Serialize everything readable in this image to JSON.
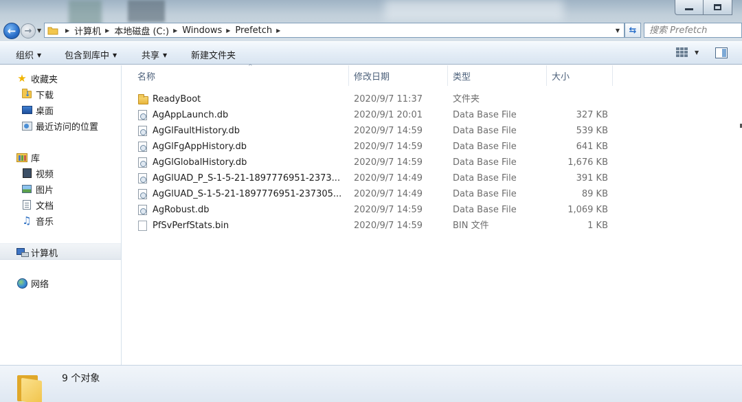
{
  "address": {
    "breadcrumbs": [
      "计算机",
      "本地磁盘 (C:)",
      "Windows",
      "Prefetch"
    ]
  },
  "search": {
    "placeholder": "搜索 Prefetch"
  },
  "toolbar": {
    "organize": "组织",
    "include_library": "包含到库中",
    "share": "共享",
    "new_folder": "新建文件夹"
  },
  "nav": {
    "favorites": "收藏夹",
    "downloads": "下载",
    "desktop": "桌面",
    "recent": "最近访问的位置",
    "libraries": "库",
    "videos": "视频",
    "pictures": "图片",
    "documents": "文档",
    "music": "音乐",
    "computer": "计算机",
    "network": "网络"
  },
  "columns": {
    "name": "名称",
    "modified": "修改日期",
    "type": "类型",
    "size": "大小"
  },
  "files": [
    {
      "name": "ReadyBoot",
      "modified": "2020/9/7 11:37",
      "type": "文件夹",
      "size": "",
      "icon": "folder-icon"
    },
    {
      "name": "AgAppLaunch.db",
      "modified": "2020/9/1 20:01",
      "type": "Data Base File",
      "size": "327 KB",
      "icon": "db-file-icon"
    },
    {
      "name": "AgGlFaultHistory.db",
      "modified": "2020/9/7 14:59",
      "type": "Data Base File",
      "size": "539 KB",
      "icon": "db-file-icon"
    },
    {
      "name": "AgGlFgAppHistory.db",
      "modified": "2020/9/7 14:59",
      "type": "Data Base File",
      "size": "641 KB",
      "icon": "db-file-icon"
    },
    {
      "name": "AgGlGlobalHistory.db",
      "modified": "2020/9/7 14:59",
      "type": "Data Base File",
      "size": "1,676 KB",
      "icon": "db-file-icon"
    },
    {
      "name": "AgGlUAD_P_S-1-5-21-1897776951-2373...",
      "modified": "2020/9/7 14:49",
      "type": "Data Base File",
      "size": "391 KB",
      "icon": "db-file-icon"
    },
    {
      "name": "AgGlUAD_S-1-5-21-1897776951-237305...",
      "modified": "2020/9/7 14:49",
      "type": "Data Base File",
      "size": "89 KB",
      "icon": "db-file-icon"
    },
    {
      "name": "AgRobust.db",
      "modified": "2020/9/7 14:59",
      "type": "Data Base File",
      "size": "1,069 KB",
      "icon": "db-file-icon"
    },
    {
      "name": "PfSvPerfStats.bin",
      "modified": "2020/9/7 14:59",
      "type": "BIN 文件",
      "size": "1 KB",
      "icon": "bin-file-icon"
    }
  ],
  "status": {
    "item_count": "9 个对象"
  },
  "colors": {
    "accent": "#2a6fc9",
    "secondary_text": "#6d6d6d",
    "header_text": "#4c607a"
  }
}
